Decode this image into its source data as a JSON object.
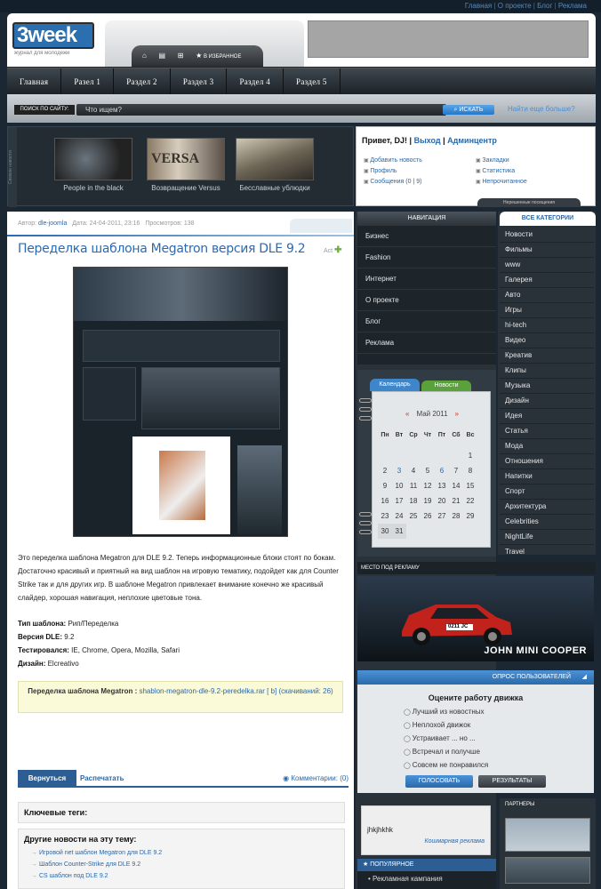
{
  "topnav": [
    "Главная",
    "О проекте",
    "Блог",
    "Реклама"
  ],
  "logo": {
    "text": "3week",
    "tagline": "журнал для молодежи"
  },
  "iconbar": {
    "favorites": "В ИЗБРАННОЕ"
  },
  "mainnav": [
    "Главная",
    "Разел 1",
    "Раздел 2",
    "Раздел 3",
    "Раздел 4",
    "Раздел 5"
  ],
  "search": {
    "label": "ПОИСК ПО САЙТУ:",
    "placeholder": "Что ищем?",
    "button": "ИСКАТЬ",
    "more": "Найти еще больше?"
  },
  "slider": {
    "side_label": "Свежие новости",
    "items": [
      {
        "caption": "People in the black"
      },
      {
        "caption": "Возвращение Versus"
      },
      {
        "caption": "Бесславные ублюдки"
      }
    ]
  },
  "user": {
    "greeting": "Привет, DJ!",
    "logout": "Выход",
    "admin": "Админцентр",
    "links_left": [
      "Добавить новость",
      "Профиль",
      "Сообщения (0 | 9)"
    ],
    "links_right": [
      "Закладки",
      "Статистика",
      "Непрочитанное"
    ],
    "tab": "Нерешенные посещения"
  },
  "article": {
    "author_label": "Автор:",
    "author": "dle-joomla",
    "date": "Дата: 24-04-2011, 23:16",
    "views": "Просмотров: 138",
    "title": "Переделка шаблона Megatron версия DLE 9.2",
    "edit": "Act",
    "body": "Это переделка шаблона Megatron для DLE 9.2. Теперь информационные блоки стоят по бокам. Достаточно красивый и приятный на вид шаблон на игровую тематику, подойдет как для Counter Strike так и для других игр. В шаблоне Megatron привлекает внимание конечно же красивый слайдер, хорошая навигация, неплохие цветовые тона.",
    "specs": [
      {
        "k": "Тип шаблона:",
        "v": " Рип/Переделка"
      },
      {
        "k": "Версия DLE:",
        "v": " 9.2"
      },
      {
        "k": "Тестировался:",
        "v": " IE, Chrome, Opera, Mozilla, Safari"
      },
      {
        "k": "Дизайн:",
        "v": " Elcreativo"
      }
    ],
    "download_label": "Переделка шаблона Megatron :",
    "download_link": "shablon-megatron-dle-9.2-peredelka.rar",
    "download_info": "[ b] (скачиваний: 26)",
    "tab_back": "Вернуться",
    "tab_print": "Распечатать",
    "comments": "Комментарии: (0)",
    "tags_title": "Ключевые теги:",
    "related_title": "Другие новости на эту тему:",
    "related": [
      "Игровой net шаблон Megatron для DLE 9.2",
      "Шаблон Counter-Strike для DLE 9.2",
      "CS шаблон под DLE 9.2"
    ]
  },
  "navigation": {
    "title": "НАВИГАЦИЯ",
    "items": [
      "Бизнес",
      "Fashion",
      "Интернет",
      "О проекте",
      "Блог",
      "Реклама"
    ]
  },
  "calendar": {
    "tab_calendar": "Календарь",
    "tab_news": "Новости",
    "prev": "«",
    "month": "Май 2011",
    "next": "»",
    "days": [
      "Пн",
      "Вт",
      "Ср",
      "Чт",
      "Пт",
      "Сб",
      "Вс"
    ],
    "dates": [
      "",
      "",
      "",
      "",
      "",
      "",
      "1",
      "2",
      "3",
      "4",
      "5",
      "6",
      "7",
      "8",
      "9",
      "10",
      "11",
      "12",
      "13",
      "14",
      "15",
      "16",
      "17",
      "18",
      "19",
      "20",
      "21",
      "22",
      "23",
      "24",
      "25",
      "26",
      "27",
      "28",
      "29",
      "30",
      "31"
    ],
    "linked": [
      "3",
      "6"
    ]
  },
  "categories": {
    "title": "ВСЕ КАТЕГОРИИ",
    "items": [
      "Новости",
      "Фильмы",
      "www",
      "Галерея",
      "Авто",
      "Игры",
      "hi-tech",
      "Видео",
      "Креатив",
      "Клипы",
      "Музыка",
      "Дизайн",
      "Идея",
      "Статья",
      "Мода",
      "Отношения",
      "Напитки",
      "Спорт",
      "Архитектура",
      "Celebrities",
      "NightLife",
      "Travel"
    ]
  },
  "ad": {
    "title": "МЕСТО ПОД РЕКЛАМУ",
    "caption": "JOHN MINI COOPER",
    "plate": "0211 JC"
  },
  "poll": {
    "title": "ОПРОС ПОЛЬЗОВАТЕЛЕЙ",
    "question": "Оцените работу движка",
    "options": [
      "Лучший из новостных",
      "Неплохой движок",
      "Устраивает ... но ...",
      "Встречал и получше",
      "Совсем не понравился"
    ],
    "vote": "ГОЛОСОВАТЬ",
    "results": "РЕЗУЛЬТАТЫ"
  },
  "sticky": {
    "text": "jhkjhkhk",
    "sign": "Кошмарная реклама"
  },
  "partners": {
    "title": "ПАРТНЕРЫ"
  },
  "popular": {
    "title": "ПОПУЛЯРНОЕ",
    "first": "Рекламная кампания"
  }
}
